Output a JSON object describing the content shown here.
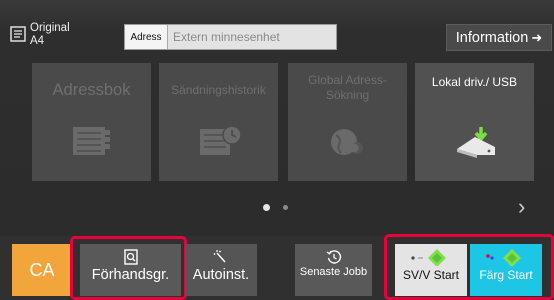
{
  "header": {
    "original_label": "Original",
    "original_size": "A4",
    "address_label": "Adress",
    "address_placeholder": "Extern minnesenhet",
    "info_label": "Information",
    "info_arrow": "➜"
  },
  "tiles": [
    {
      "label": "Adressbok",
      "icon": "address-book-icon",
      "enabled": false
    },
    {
      "label": "Sändningshistorik",
      "icon": "send-history-icon",
      "enabled": false
    },
    {
      "label": "Global Adress-Sökning",
      "icon": "global-search-icon",
      "enabled": false
    },
    {
      "label": "Lokal driv./ USB",
      "icon": "usb-drive-icon",
      "enabled": true
    }
  ],
  "pager": {
    "current": 1,
    "total": 2,
    "next": "›"
  },
  "bottom": {
    "ca_label": "CA",
    "preview_label": "Förhandsgr.",
    "auto_label": "Autoinst.",
    "recent_label": "Senaste Jobb",
    "bw_start_label": "SV/V Start",
    "color_start_label": "Färg Start"
  },
  "colors": {
    "ca": "#f2a53b",
    "highlight": "#e8003d",
    "bw_start": "#e4e4e4",
    "color_start": "#1ec6e6",
    "start_diamond": "#7fe04a"
  }
}
